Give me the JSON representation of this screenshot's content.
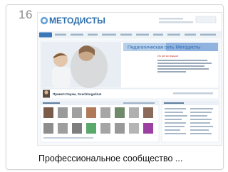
{
  "item": {
    "index": "16",
    "caption": "Профессиональное сообщество ..."
  },
  "site": {
    "logo": "МЕТОДИСТЫ",
    "banner_title": "Педагогическая сеть Методисты",
    "announcement": "Из регистрации",
    "greeting": "Приветствуем, Svechkogalina!"
  },
  "colors": {
    "brand": "#2d6fae",
    "banner": "#8fb3de",
    "accent_red": "#c0392b"
  }
}
